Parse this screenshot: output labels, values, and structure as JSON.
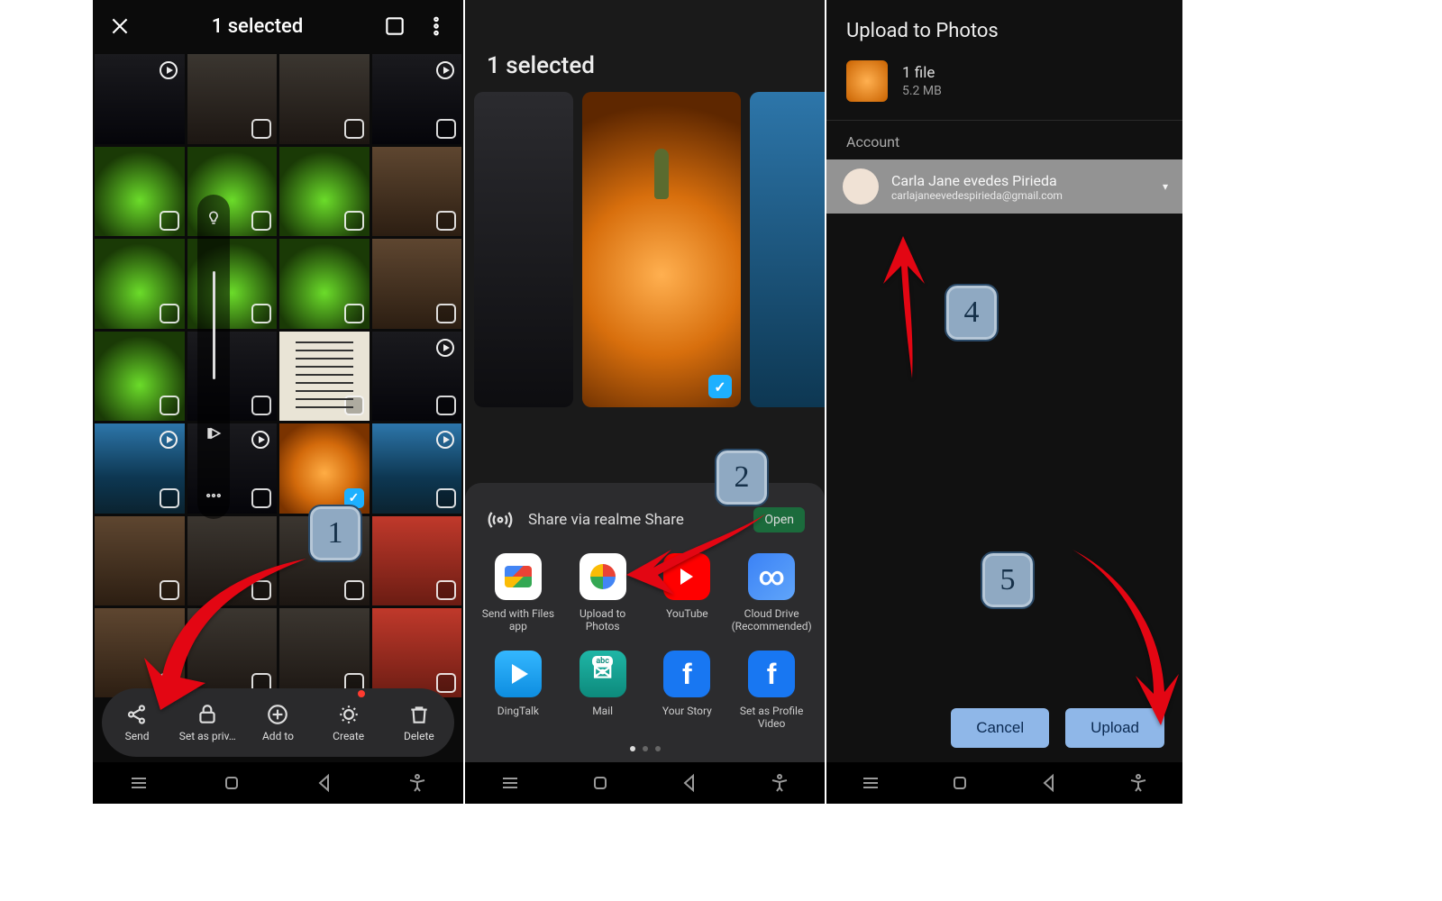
{
  "phone1": {
    "title": "1 selected",
    "bottombar": [
      {
        "icon": "share",
        "label": "Send"
      },
      {
        "icon": "lock",
        "label": "Set as priv…"
      },
      {
        "icon": "plus",
        "label": "Add to"
      },
      {
        "icon": "bulb",
        "label": "Create",
        "badge": true
      },
      {
        "icon": "trash",
        "label": "Delete"
      }
    ]
  },
  "phone2": {
    "title": "1 selected",
    "share_header": "Share via realme Share",
    "share_open": "Open",
    "apps": [
      "Send with Files app",
      "Upload to Photos",
      "YouTube",
      "Cloud Drive (Recommended)",
      "DingTalk",
      "Mail",
      "Your Story",
      "Set as Profile Video"
    ]
  },
  "phone3": {
    "title": "Upload to Photos",
    "file_count": "1 file",
    "file_size": "5.2 MB",
    "account_label": "Account",
    "account_name": "Carla Jane evedes Pirieda",
    "account_email": "carlajaneevedespirieda@gmail.com",
    "cancel": "Cancel",
    "upload": "Upload"
  },
  "steps": {
    "s1": "1",
    "s2": "2",
    "s3": "4",
    "s4": "5"
  }
}
